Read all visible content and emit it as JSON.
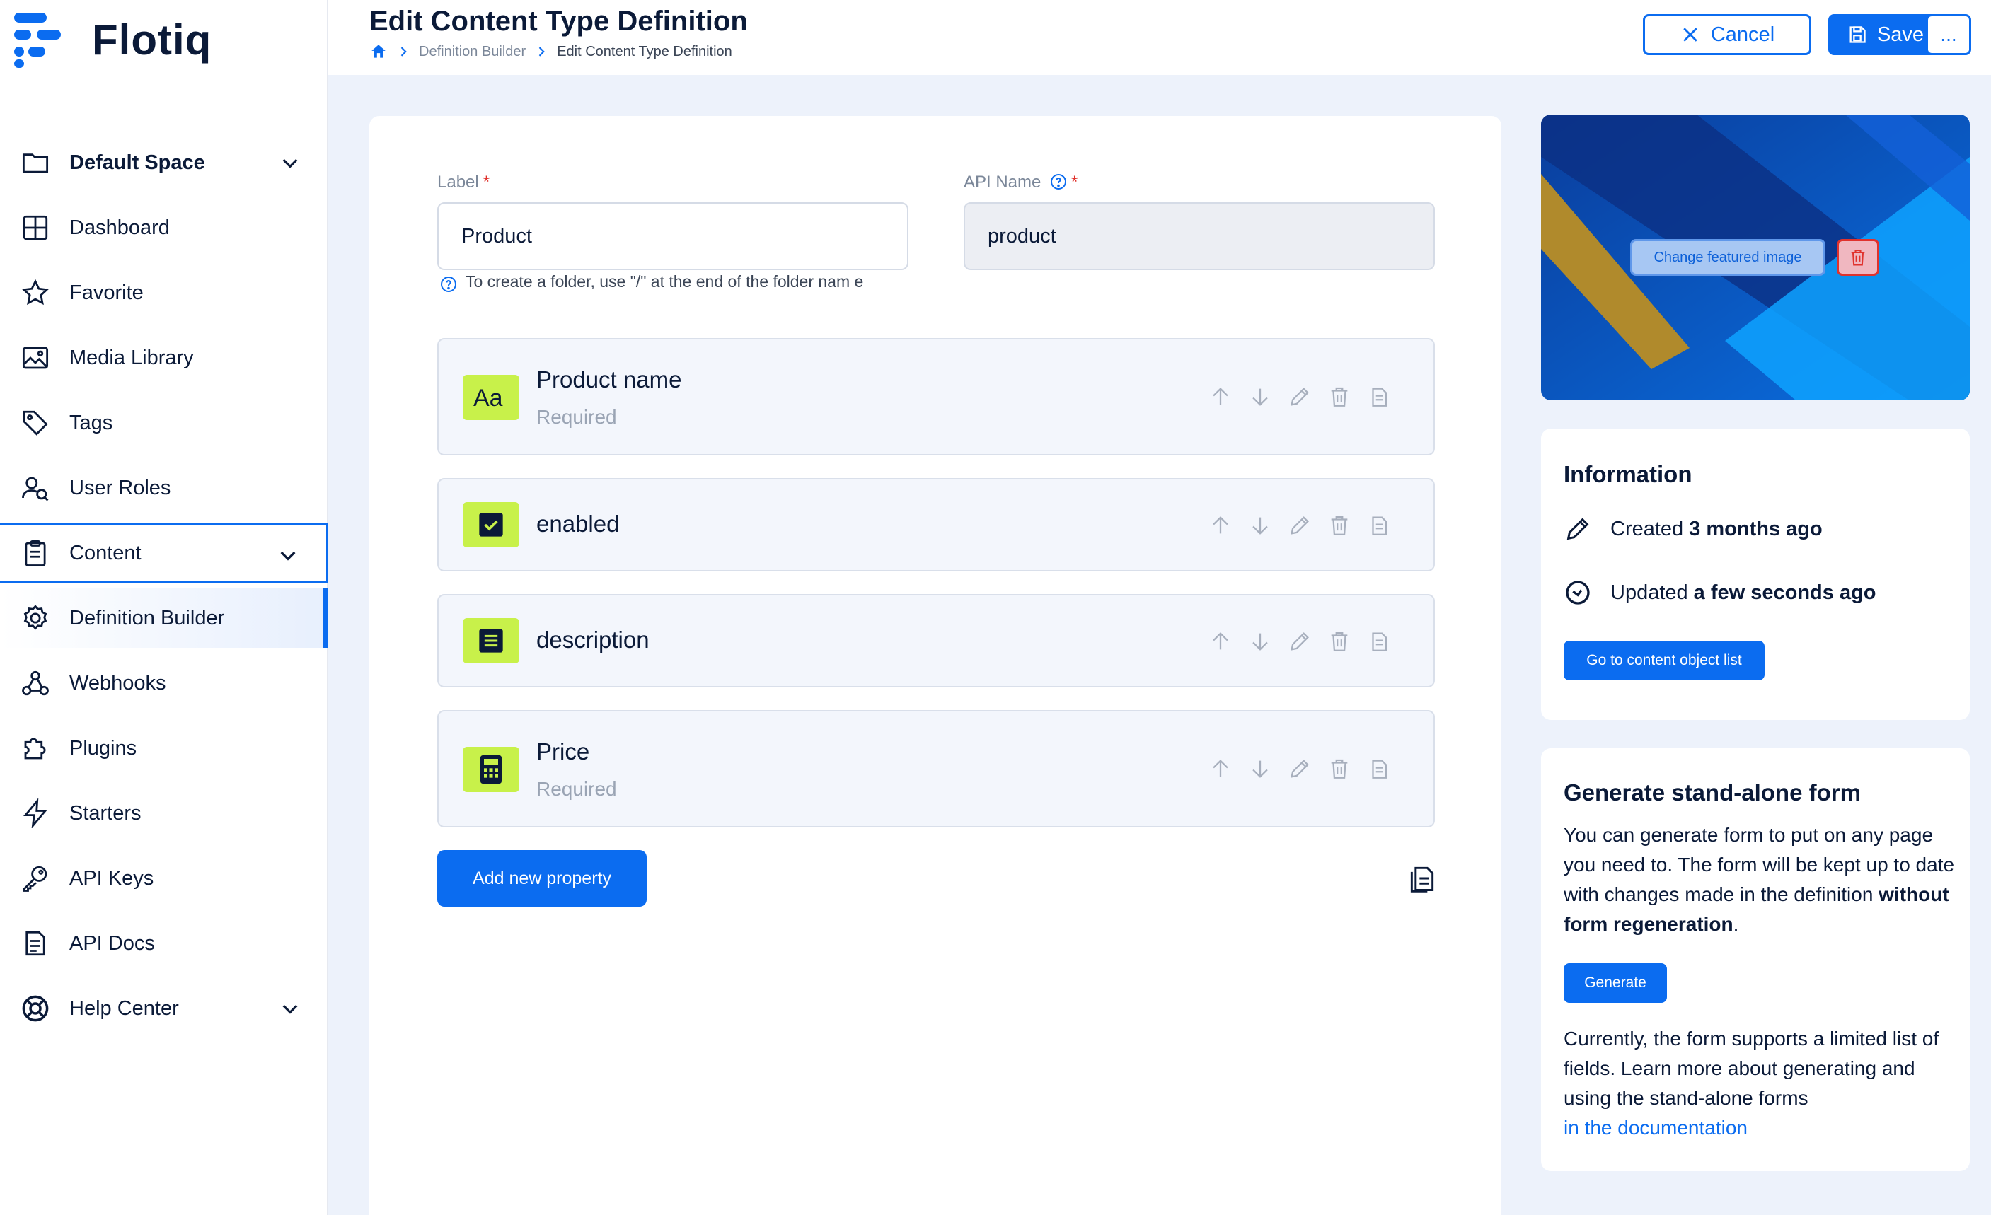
{
  "app": {
    "logo_text": "Flotiq"
  },
  "sidebar": {
    "items": [
      {
        "label": "Default Space",
        "icon": "folder-icon"
      },
      {
        "label": "Dashboard",
        "icon": "dashboard-icon"
      },
      {
        "label": "Favorite",
        "icon": "star-icon"
      },
      {
        "label": "Media Library",
        "icon": "image-icon"
      },
      {
        "label": "Tags",
        "icon": "tag-icon"
      },
      {
        "label": "User Roles",
        "icon": "user-roles-icon"
      },
      {
        "label": "Content",
        "icon": "clipboard-icon"
      },
      {
        "label": "Definition Builder",
        "icon": "gear-icon"
      },
      {
        "label": "Webhooks",
        "icon": "webhooks-icon"
      },
      {
        "label": "Plugins",
        "icon": "puzzle-icon"
      },
      {
        "label": "Starters",
        "icon": "lightning-icon"
      },
      {
        "label": "API Keys",
        "icon": "key-icon"
      },
      {
        "label": "API Docs",
        "icon": "document-icon"
      },
      {
        "label": "Help Center",
        "icon": "lifebuoy-icon"
      }
    ]
  },
  "header": {
    "title": "Edit Content Type Definition",
    "breadcrumb": {
      "parent": "Definition Builder",
      "current": "Edit Content Type Definition"
    },
    "cancel_label": "Cancel",
    "save_label": "Save",
    "more_label": "..."
  },
  "form": {
    "label_field": {
      "label": "Label",
      "required_mark": "*",
      "value": "Product",
      "hint": "To create a folder, use \"/\" at the end of the folder nam e"
    },
    "api_name_field": {
      "label": "API Name",
      "required_mark": "*",
      "value": "product"
    },
    "properties": [
      {
        "name": "Product name",
        "sub": "Required",
        "type_icon": "text-type-icon"
      },
      {
        "name": "enabled",
        "sub": "",
        "type_icon": "checkbox-type-icon"
      },
      {
        "name": "description",
        "sub": "",
        "type_icon": "textarea-type-icon"
      },
      {
        "name": "Price",
        "sub": "Required",
        "type_icon": "number-type-icon"
      }
    ],
    "add_property_label": "Add new property"
  },
  "featured": {
    "change_label": "Change featured image"
  },
  "information": {
    "title": "Information",
    "created_prefix": "Created",
    "created_value": "3 months ago",
    "updated_prefix": "Updated",
    "updated_value": "a few seconds ago",
    "button_label": "Go to content object list"
  },
  "standalone": {
    "title": "Generate stand-alone form",
    "text_1": "You can generate form to put on any page you need to. The form will be kept up to date with changes made in the definition",
    "text_1_bold": "without form regeneration",
    "text_1_end": ".",
    "button_label": "Generate",
    "text_2": "Currently, the form supports a limited list of fields. Learn more about generating and using the stand-alone forms",
    "link_label": "in the documentation"
  },
  "colors": {
    "accent": "#0b6cf0",
    "badge": "#c8f14a",
    "danger": "#e0322d",
    "navy": "#0b1a38"
  }
}
